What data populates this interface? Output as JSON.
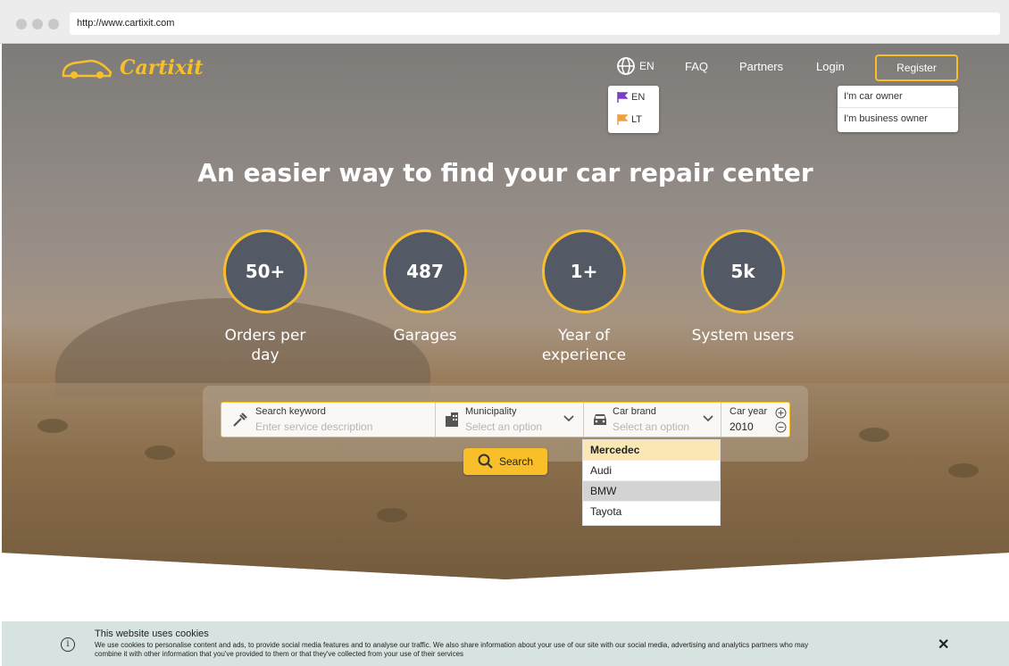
{
  "browser": {
    "url": "http://www.cartixit.com"
  },
  "header": {
    "logo_text": "Cartixit",
    "language": "EN",
    "nav": [
      "FAQ",
      "Partners",
      "Login"
    ],
    "register_label": "Register"
  },
  "language_menu": [
    {
      "code": "EN",
      "flag_color": "#7b3fc4"
    },
    {
      "code": "LT",
      "flag_color": "#f0a040"
    }
  ],
  "register_menu": [
    "I'm car owner",
    "I'm business owner"
  ],
  "headline": "An easier way to find your car repair center",
  "stats": [
    {
      "value": "50+",
      "label": "Orders per day"
    },
    {
      "value": "487",
      "label": "Garages"
    },
    {
      "value": "1+",
      "label": "Year of experience"
    },
    {
      "value": "5k",
      "label": "System users"
    }
  ],
  "search": {
    "keyword_label": "Search keyword",
    "keyword_placeholder": "Enter service description",
    "municipality_label": "Municipality",
    "municipality_placeholder": "Select an option",
    "brand_label": "Car brand",
    "brand_placeholder": "Select an option",
    "year_label": "Car year",
    "year_value": "2010",
    "button_label": "Search"
  },
  "brand_options": [
    "Mercedec",
    "Audi",
    "BMW",
    "Tayota"
  ],
  "cookie": {
    "title": "This website uses cookies",
    "body": "We use cookies to personalise content and ads, to provide social media features and to analyse our traffic. We also share information about your use of our site with our social media, advertising and analytics partners who may combine it with other information that you've provided to them or that they've collected from your use of their services"
  },
  "colors": {
    "accent": "#f8bf2a",
    "stat_circle": "#535a66",
    "cookie_bg": "#d7e3e0"
  }
}
